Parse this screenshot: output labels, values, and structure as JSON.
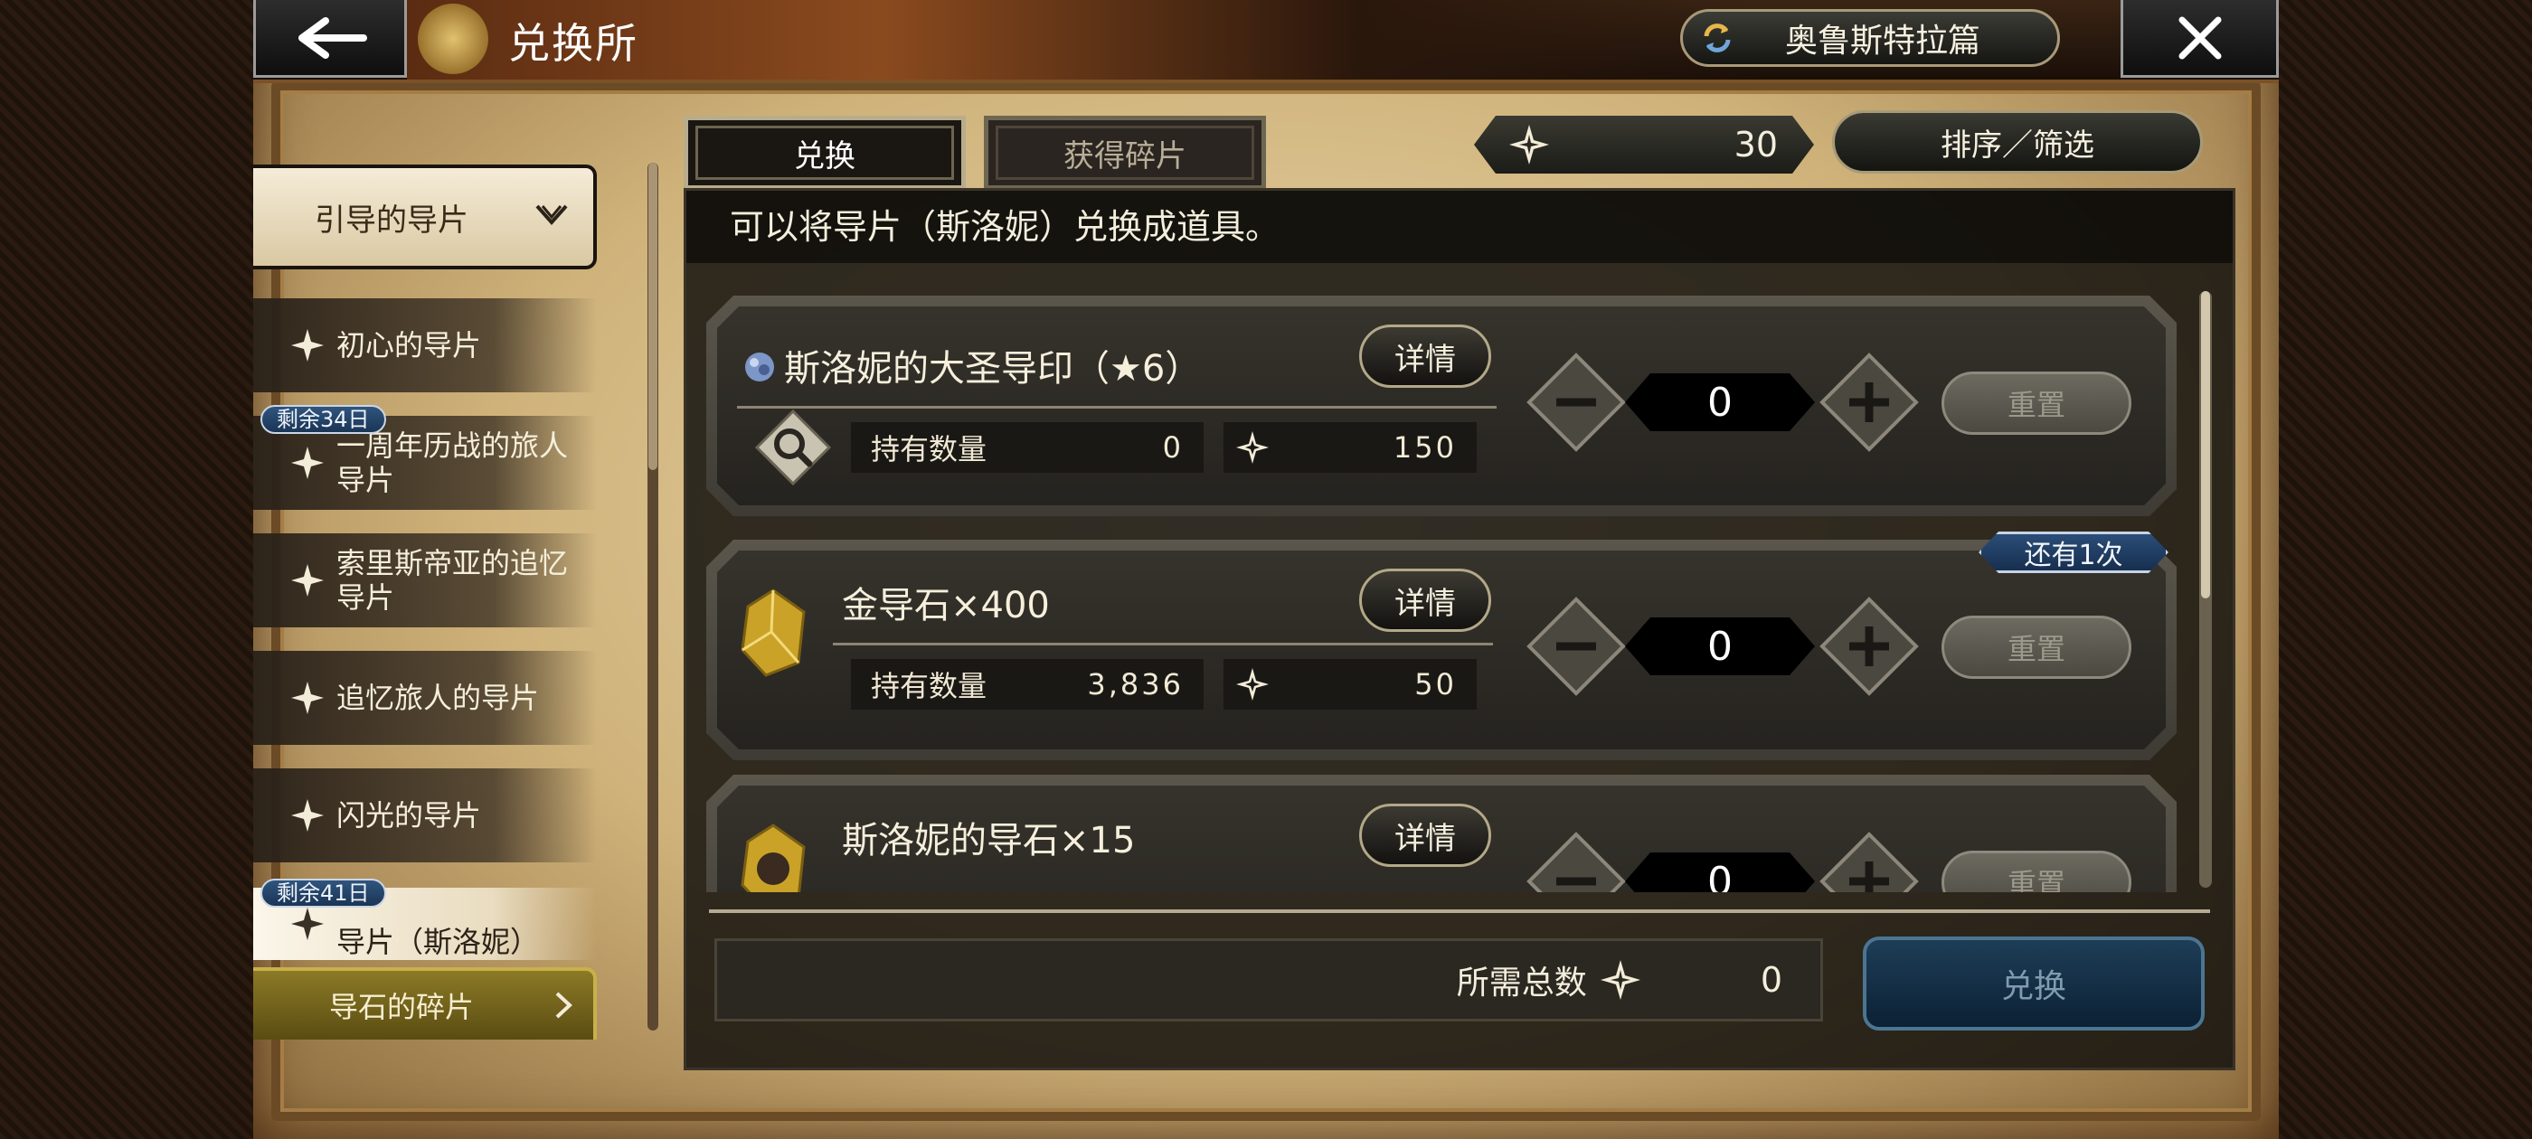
{
  "header": {
    "title": "兑换所",
    "story_selector": "奥鲁斯特拉篇"
  },
  "nav": {
    "dropdown_label": "引导的导片",
    "items": [
      {
        "label": "初心的导片",
        "badge": ""
      },
      {
        "label": "一周年历战的旅人导片",
        "badge": "剩余34日"
      },
      {
        "label": "索里斯帝亚的追忆导片",
        "badge": ""
      },
      {
        "label": "追忆旅人的导片",
        "badge": ""
      },
      {
        "label": "闪光的导片",
        "badge": ""
      },
      {
        "label": "导片（斯洛妮）",
        "badge": "剩余41日"
      }
    ],
    "fragment_label": "导石的碎片"
  },
  "tabs": {
    "exchange": "兑换",
    "get_fragments": "获得碎片"
  },
  "currency": {
    "value": "30"
  },
  "sort_filter_label": "排序／筛选",
  "description": "可以将导片（斯洛妮）兑换成道具。",
  "labels": {
    "detail": "详情",
    "owned": "持有数量",
    "reset": "重置"
  },
  "items": [
    {
      "name": "斯洛妮的大圣导印（★6）",
      "owned": "0",
      "cost": "150",
      "quantity": "0"
    },
    {
      "name": "金导石×400",
      "owned": "3,836",
      "cost": "50",
      "quantity": "0",
      "remaining_badge": "还有1次"
    },
    {
      "name": "斯洛妮的导石×15",
      "owned": "",
      "cost": "",
      "quantity": "0"
    }
  ],
  "footer": {
    "total_label": "所需总数",
    "total_value": "0",
    "exchange_button": "兑换"
  },
  "colors": {
    "accent_gold": "#c8b04a",
    "badge_blue": "#2b4d78",
    "exchange_button": "#1e3d57"
  }
}
